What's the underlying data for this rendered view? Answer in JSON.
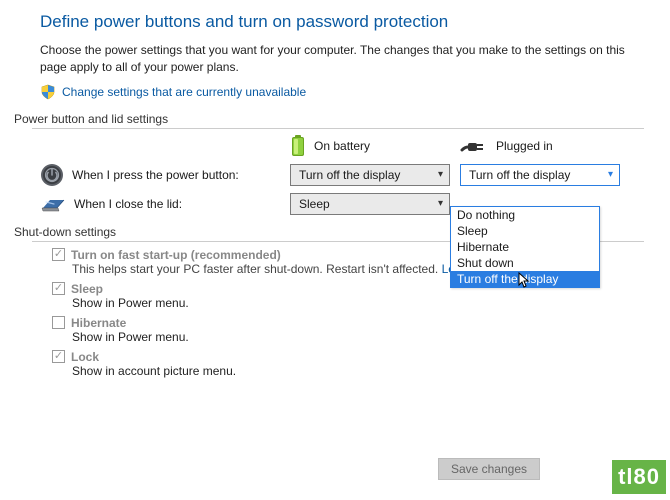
{
  "header": {
    "title": "Define power buttons and turn on password protection",
    "description": "Choose the power settings that you want for your computer. The changes that you make to the settings on this page apply to all of your power plans.",
    "change_link": "Change settings that are currently unavailable"
  },
  "section_pb": {
    "label": "Power button and lid settings",
    "col_battery": "On battery",
    "col_plugged": "Plugged in",
    "rows": {
      "power_button": {
        "label": "When I press the power button:",
        "battery_value": "Turn off the display",
        "plugged_value": "Turn off the display"
      },
      "close_lid": {
        "label": "When I close the lid:",
        "battery_value": "Sleep",
        "plugged_value": ""
      }
    }
  },
  "dropdown": {
    "options": [
      "Do nothing",
      "Sleep",
      "Hibernate",
      "Shut down",
      "Turn off the display"
    ],
    "selected": "Turn off the display"
  },
  "section_sd": {
    "label": "Shut-down settings",
    "items": {
      "fast_startup": {
        "label": "Turn on fast start-up (recommended)",
        "desc": "This helps start your PC faster after shut-down. Restart isn't affected. ",
        "learn_more": "Learn More"
      },
      "sleep": {
        "label": "Sleep",
        "desc": "Show in Power menu."
      },
      "hibernate": {
        "label": "Hibernate",
        "desc": "Show in Power menu."
      },
      "lock": {
        "label": "Lock",
        "desc": "Show in account picture menu."
      }
    }
  },
  "footer": {
    "save": "Save changes"
  },
  "watermark": "tl80"
}
